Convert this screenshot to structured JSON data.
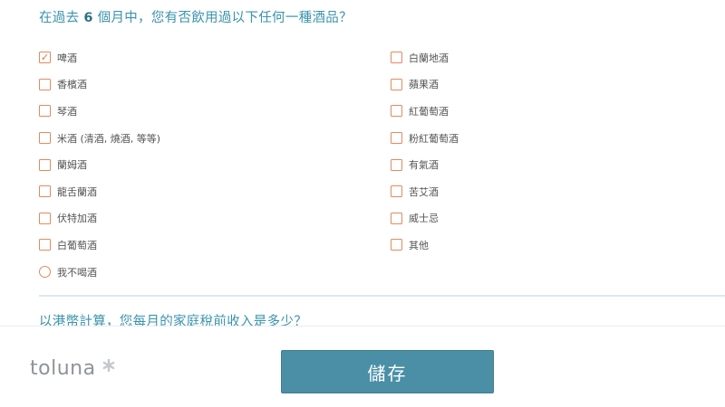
{
  "question1": {
    "prefix": "在過去",
    "number": "6",
    "suffix": "個月中，您有否飲用過以下任何一種酒品？"
  },
  "options_left": [
    {
      "label": "啤酒",
      "checked": true
    },
    {
      "label": "香檳酒",
      "checked": false
    },
    {
      "label": "琴酒",
      "checked": false
    },
    {
      "label": "米酒 (清酒, 燒酒, 等等)",
      "checked": false
    },
    {
      "label": "蘭姆酒",
      "checked": false
    },
    {
      "label": "龍舌蘭酒",
      "checked": false
    },
    {
      "label": "伏特加酒",
      "checked": false
    },
    {
      "label": "白葡萄酒",
      "checked": false
    }
  ],
  "options_right": [
    {
      "label": "白蘭地酒",
      "checked": false
    },
    {
      "label": "蘋果酒",
      "checked": false
    },
    {
      "label": "紅葡萄酒",
      "checked": false
    },
    {
      "label": "粉紅葡萄酒",
      "checked": false
    },
    {
      "label": "有氣酒",
      "checked": false
    },
    {
      "label": "苦艾酒",
      "checked": false
    },
    {
      "label": "威士忌",
      "checked": false
    },
    {
      "label": "其他",
      "checked": false
    }
  ],
  "exclusive_option": {
    "label": "我不喝酒",
    "selected": false
  },
  "question2": {
    "text": "以港幣計算，您每月的家庭稅前收入是多少？"
  },
  "footer": {
    "logo_text": "toluna",
    "save_label": "儲存"
  },
  "colors": {
    "accent": "#3a93ad",
    "checkbox_border": "#e28a5e",
    "button_bg": "#4a8fa6"
  }
}
